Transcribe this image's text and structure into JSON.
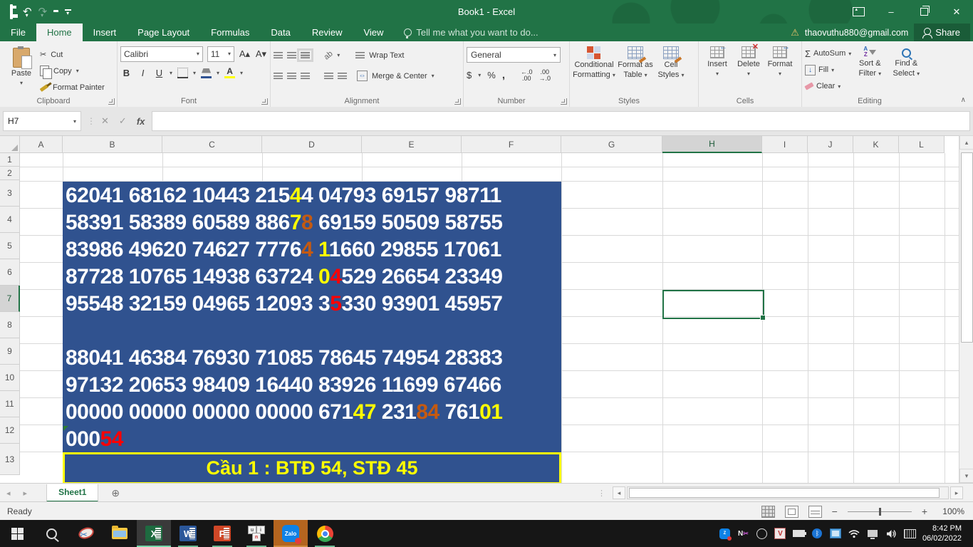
{
  "window": {
    "title": "Book1 - Excel",
    "account": "thaovuthu880@gmail.com",
    "share_label": "Share"
  },
  "icons": {
    "undo": "↶",
    "redo": "↷",
    "dropdown": "▾",
    "cut_glyph": "✂",
    "cancel": "✕",
    "enter": "✓",
    "fx": "fx",
    "sigma": "Σ",
    "warning": "⚠",
    "add_sheet": "⊕",
    "dots": "⋮",
    "left": "◂",
    "right": "▸",
    "up": "▴",
    "down": "▾",
    "collapse": "∧",
    "minimize": "–",
    "close": "✕",
    "dollar": "$",
    "percent": "%",
    "comma": ",",
    "inc_decimal": "←.0\n.00",
    "dec_decimal": ".00\n→.0",
    "grow_font": "A▴",
    "shrink_font": "A▾",
    "wrap_return": "↵",
    "zoom_out": "−",
    "zoom_in": "+"
  },
  "ribbon_tabs": {
    "items": [
      "File",
      "Home",
      "Insert",
      "Page Layout",
      "Formulas",
      "Data",
      "Review",
      "View"
    ],
    "active": "Home",
    "tell_me": "Tell me what you want to do..."
  },
  "ribbon": {
    "clipboard": {
      "label": "Clipboard",
      "paste": "Paste",
      "cut": "Cut",
      "copy": "Copy",
      "format_painter": "Format Painter"
    },
    "font": {
      "label": "Font",
      "font_name": "Calibri",
      "font_size": "11",
      "bold": "B",
      "italic": "I",
      "underline": "U"
    },
    "alignment": {
      "label": "Alignment",
      "wrap_text": "Wrap Text",
      "merge_center": "Merge & Center"
    },
    "number": {
      "label": "Number",
      "format": "General"
    },
    "styles": {
      "label": "Styles",
      "conditional_line1": "Conditional",
      "conditional_line2": "Formatting",
      "format_table_line1": "Format as",
      "format_table_line2": "Table",
      "cell_styles_line1": "Cell",
      "cell_styles_line2": "Styles"
    },
    "cells": {
      "label": "Cells",
      "insert": "Insert",
      "delete": "Delete",
      "format": "Format"
    },
    "editing": {
      "label": "Editing",
      "autosum": "AutoSum",
      "fill": "Fill",
      "clear": "Clear",
      "sort_line1": "Sort &",
      "sort_line2": "Filter",
      "find_line1": "Find &",
      "find_line2": "Select"
    }
  },
  "formula_bar": {
    "name_box": "H7",
    "formula": ""
  },
  "grid": {
    "columns": [
      "A",
      "B",
      "C",
      "D",
      "E",
      "F",
      "G",
      "H",
      "I",
      "J",
      "K",
      "L"
    ],
    "selected_column": "H",
    "rows": [
      "1",
      "2",
      "3",
      "4",
      "5",
      "6",
      "7",
      "8",
      "9",
      "10",
      "11",
      "12",
      "13"
    ],
    "selected_row": "7",
    "selected_cell": "H7"
  },
  "sheet": {
    "fill_color": "#30528f",
    "digit_colors": {
      "w": "#ffffff",
      "y": "#ffff00",
      "o": "#c55a11",
      "r": "#ff0000"
    },
    "number_rows": [
      {
        "row": 3,
        "segments": [
          {
            "t": "62041 68162 10443 215",
            "c": "w"
          },
          {
            "t": "4",
            "c": "y"
          },
          {
            "t": "4 04793 69157 98711",
            "c": "w"
          }
        ]
      },
      {
        "row": 4,
        "segments": [
          {
            "t": "58391 58389 60589 886",
            "c": "w"
          },
          {
            "t": "7",
            "c": "y"
          },
          {
            "t": "8",
            "c": "o"
          },
          {
            "t": " 69159 50509 58755",
            "c": "w"
          }
        ]
      },
      {
        "row": 5,
        "segments": [
          {
            "t": "83986 49620 74627 7776",
            "c": "w"
          },
          {
            "t": "4",
            "c": "o"
          },
          {
            "t": " ",
            "c": "w"
          },
          {
            "t": "1",
            "c": "y"
          },
          {
            "t": "1660 29855 17061",
            "c": "w"
          }
        ]
      },
      {
        "row": 6,
        "segments": [
          {
            "t": "87728 10765 14938 63724 ",
            "c": "w"
          },
          {
            "t": "0",
            "c": "y"
          },
          {
            "t": "4",
            "c": "r"
          },
          {
            "t": "529 26654 23349",
            "c": "w"
          }
        ]
      },
      {
        "row": 7,
        "segments": [
          {
            "t": "95548 32159 04965 12093 3",
            "c": "w"
          },
          {
            "t": "5",
            "c": "r"
          },
          {
            "t": "330 93901 45957",
            "c": "w"
          }
        ]
      },
      {
        "row": 9,
        "segments": [
          {
            "t": "88041 46384 76930 71085 78645 74954 28383",
            "c": "w"
          }
        ]
      },
      {
        "row": 10,
        "segments": [
          {
            "t": "97132 20653 98409 16440 83926 11699 67466",
            "c": "w"
          }
        ]
      },
      {
        "row": 11,
        "segments": [
          {
            "t": "00000 00000 00000 00000 671",
            "c": "w"
          },
          {
            "t": "47",
            "c": "y"
          },
          {
            "t": " 231",
            "c": "w"
          },
          {
            "t": "84",
            "c": "o"
          },
          {
            "t": " 761",
            "c": "w"
          },
          {
            "t": "01",
            "c": "y"
          }
        ]
      },
      {
        "row": 12,
        "segments": [
          {
            "t": "000",
            "c": "w"
          },
          {
            "t": "54",
            "c": "r"
          }
        ]
      }
    ],
    "banner": {
      "text": "Cầu 1 : BTĐ 54, STĐ 45",
      "text_color": "#ffff00",
      "border_color": "#ffff00"
    }
  },
  "sheet_tabs": {
    "active": "Sheet1"
  },
  "status_bar": {
    "mode": "Ready",
    "zoom_level": "100%"
  },
  "taskbar": {
    "apps": [
      "start",
      "search",
      "snipping-tool",
      "file-explorer",
      "excel",
      "word",
      "powerpoint",
      "unikey",
      "zalo",
      "chrome"
    ],
    "active_app": "excel",
    "tray": [
      "zalo",
      "unikey",
      "screen-capture",
      "v-app",
      "battery",
      "bluetooth",
      "remote-desktop",
      "wifi",
      "display",
      "volume",
      "touch-keyboard"
    ],
    "clock": {
      "time": "8:42 PM",
      "date": "06/02/2022"
    }
  }
}
